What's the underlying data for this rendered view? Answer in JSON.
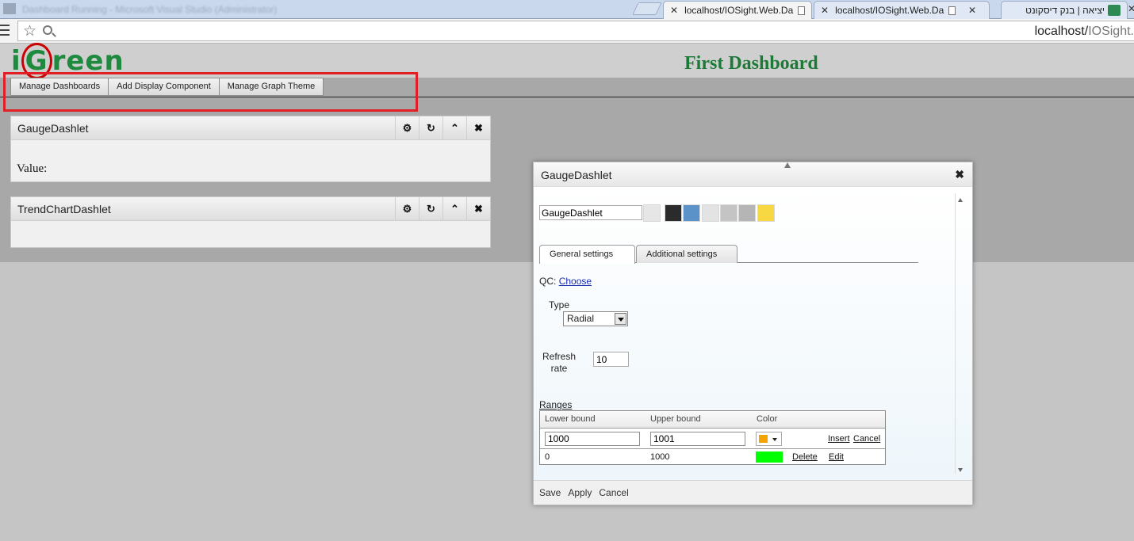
{
  "browser": {
    "tabs": [
      {
        "label": "localhost/IOSight.Web.Da",
        "active": true
      },
      {
        "label": "localhost/IOSight.Web.Da",
        "active": false
      },
      {
        "label": "יציאה | בנק דיסקונט",
        "active": false
      }
    ],
    "url_host": "localhost/",
    "url_path": "IOSight.",
    "blurred_title": "Dashboard Running - Microsoft Visual Studio (Administrator)"
  },
  "header": {
    "logo_prefix": "i",
    "logo_g": "G",
    "logo_suffix": "reen",
    "title": "First Dashboard",
    "title_color": "#1d7a36"
  },
  "toolbar": {
    "manage_dashboards": "Manage Dashboards",
    "add_display_component": "Add Display Component",
    "manage_graph_theme": "Manage Graph Theme"
  },
  "dashlets": [
    {
      "title": "GaugeDashlet",
      "value_label": "Value:"
    },
    {
      "title": "TrendChartDashlet"
    }
  ],
  "dialog": {
    "title": "GaugeDashlet",
    "name_value": "GaugeDashlet",
    "theme_swatches": [
      "#e6e6e6",
      "#2b2b2b",
      "#5b93c8",
      "#e3e3e3",
      "#c4c4c4",
      "#b5b5b5",
      "#f7d842"
    ],
    "tabs": {
      "general": "General settings",
      "additional": "Additional settings"
    },
    "qc_label": "QC:",
    "qc_link": "Choose",
    "type_label": "Type",
    "type_value": "Radial",
    "refresh_label": "Refresh rate",
    "refresh_value": "10",
    "ranges_label": "Ranges",
    "ranges": {
      "headers": {
        "lower": "Lower bound",
        "upper": "Upper bound",
        "color": "Color"
      },
      "edit_row": {
        "lower": "1000",
        "upper": "1001",
        "color": "#f5a300",
        "insert": "Insert",
        "cancel": "Cancel"
      },
      "rows": [
        {
          "lower": "0",
          "upper": "1000",
          "color": "#00ff00",
          "delete": "Delete",
          "edit": "Edit"
        }
      ]
    },
    "footer": {
      "save": "Save",
      "apply": "Apply",
      "cancel": "Cancel"
    }
  },
  "colors": {
    "highlight": "#e21e26",
    "logo": "#1e8a3e"
  }
}
